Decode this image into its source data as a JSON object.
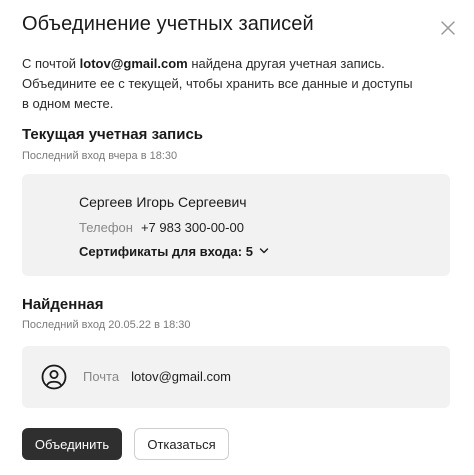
{
  "dialog": {
    "title": "Объединение учетных записей",
    "close_icon": "close-icon"
  },
  "intro": {
    "prefix": "С почтой ",
    "email": "lotov@gmail.com",
    "line1_suffix": " найдена другая учетная запись.",
    "line2": "Объедините ее с текущей, чтобы хранить все данные и доступы",
    "line3": "в одном месте."
  },
  "current_account": {
    "title": "Текущая учетная запись",
    "last_login": "Последний вход вчера в 18:30",
    "name": "Сергеев Игорь Сергеевич",
    "phone_label": "Телефон",
    "phone_value": "+7 983 300-00-00",
    "certificates": "Сертификаты для входа: 5",
    "certificates_icon": "chevron-down-icon"
  },
  "found_account": {
    "title": "Найденная",
    "last_login": "Последний вход 20.05.22 в 18:30",
    "avatar_icon": "user-circle-icon",
    "mail_label": "Почта",
    "mail_value": "lotov@gmail.com"
  },
  "actions": {
    "merge_label": "Объединить",
    "decline_label": "Отказаться"
  },
  "colors": {
    "primary_button": "#2f2f2f",
    "card_background": "#f2f2f2",
    "muted_text": "#888888"
  }
}
